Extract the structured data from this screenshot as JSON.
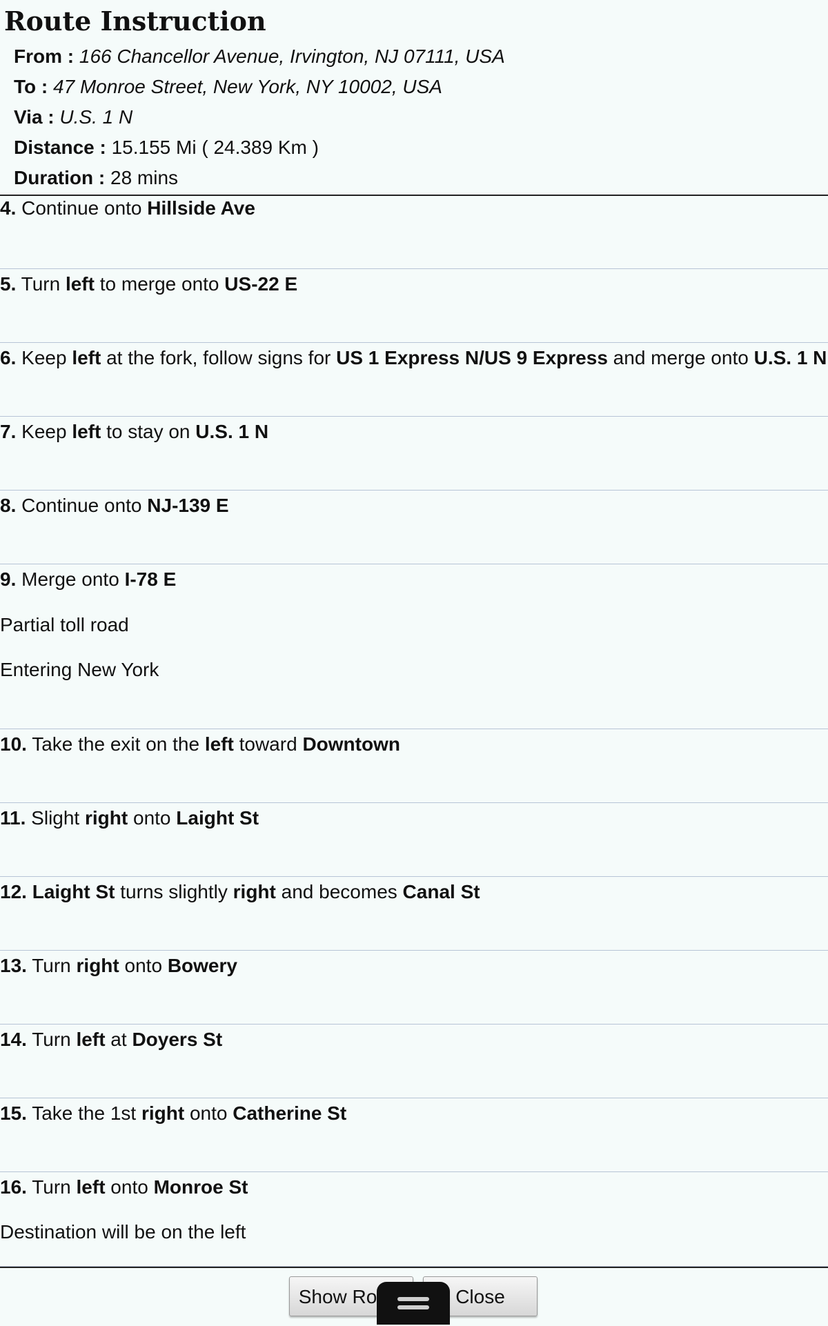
{
  "header": {
    "title": "Route Instruction",
    "from_label": "From :",
    "from_value": "166 Chancellor Avenue, Irvington, NJ 07111, USA",
    "to_label": "To :",
    "to_value": "47 Monroe Street, New York, NY 10002, USA",
    "via_label": "Via :",
    "via_value": "U.S. 1 N",
    "distance_label": "Distance :",
    "distance_value": "15.155 Mi ( 24.389 Km )",
    "duration_label": "Duration :",
    "duration_value": "28 mins"
  },
  "steps": [
    {
      "num": "4.",
      "t1": " Continue onto ",
      "b1": "Hillside Ave"
    },
    {
      "num": "5.",
      "t1": " Turn ",
      "b1": "left",
      "t2": " to merge onto ",
      "b2": "US-22 E"
    },
    {
      "num": "6.",
      "t1": " Keep ",
      "b1": "left",
      "t2": " at the fork, follow signs for ",
      "b2": "US 1 Express N/US 9 Express",
      "t3": " and merge onto ",
      "b3": "U.S. 1 N"
    },
    {
      "num": "7.",
      "t1": " Keep ",
      "b1": "left",
      "t2": " to stay on ",
      "b2": "U.S. 1 N"
    },
    {
      "num": "8.",
      "t1": " Continue onto ",
      "b1": "NJ-139 E"
    },
    {
      "num": "9.",
      "t1": " Merge onto ",
      "b1": "I-78 E",
      "note1": "Partial toll road",
      "note2": "Entering New York"
    },
    {
      "num": "10.",
      "t1": " Take the exit on the ",
      "b1": "left",
      "t2": " toward ",
      "b2": "Downtown"
    },
    {
      "num": "11.",
      "t1": " Slight ",
      "b1": "right",
      "t2": " onto ",
      "b2": "Laight St"
    },
    {
      "num": "12.",
      "t1": " ",
      "b1": "Laight St",
      "t2": " turns slightly ",
      "b2": "right",
      "t3": " and becomes ",
      "b3": "Canal St"
    },
    {
      "num": "13.",
      "t1": " Turn ",
      "b1": "right",
      "t2": " onto ",
      "b2": "Bowery"
    },
    {
      "num": "14.",
      "t1": " Turn ",
      "b1": "left",
      "t2": " at ",
      "b2": "Doyers St"
    },
    {
      "num": "15.",
      "t1": " Take the 1st ",
      "b1": "right",
      "t2": " onto ",
      "b2": "Catherine St"
    },
    {
      "num": "16.",
      "t1": " Turn ",
      "b1": "left",
      "t2": " onto ",
      "b2": "Monroe St",
      "note1": "Destination will be on the left"
    }
  ],
  "buttons": {
    "show_route": "Show Route",
    "close": "Close"
  }
}
